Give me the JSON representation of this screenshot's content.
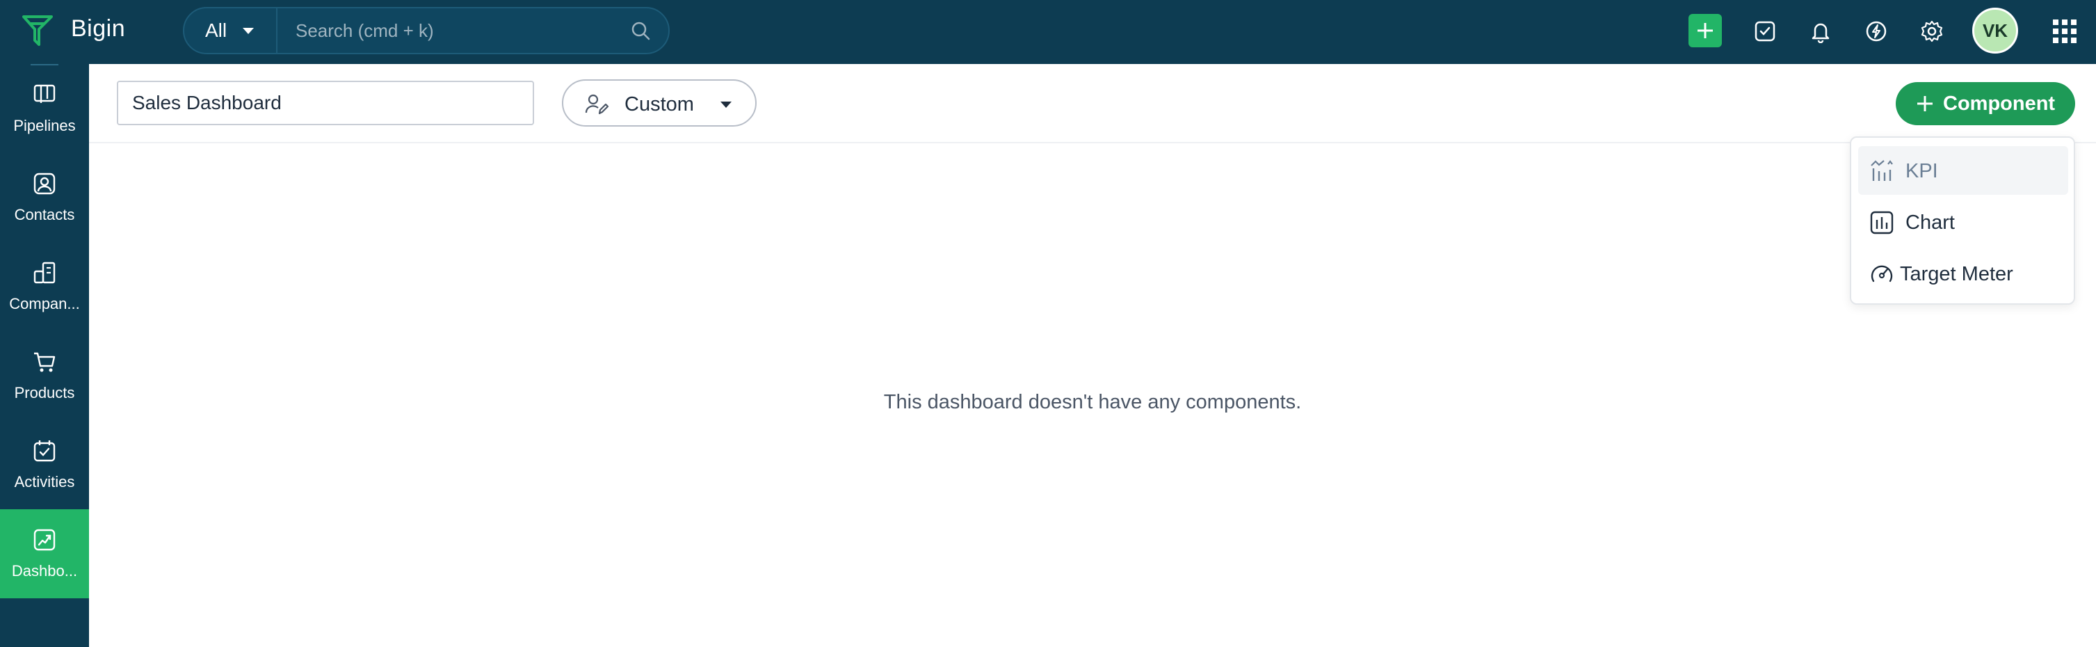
{
  "app": {
    "name": "Bigin"
  },
  "search": {
    "scope": "All",
    "placeholder": "Search (cmd + k)"
  },
  "user": {
    "initials": "VK"
  },
  "sidebar": {
    "items": [
      {
        "label": "Pipelines",
        "icon": "pipelines-icon"
      },
      {
        "label": "Contacts",
        "icon": "contacts-icon"
      },
      {
        "label": "Compan...",
        "icon": "companies-icon"
      },
      {
        "label": "Products",
        "icon": "products-icon"
      },
      {
        "label": "Activities",
        "icon": "activities-icon"
      },
      {
        "label": "Dashbo...",
        "icon": "dashboards-icon",
        "active": true
      }
    ]
  },
  "dashboard": {
    "title": "Sales Dashboard",
    "type_label": "Custom",
    "add_component_label": "Component",
    "empty_message": "This dashboard doesn't have any components."
  },
  "component_menu": {
    "items": [
      {
        "label": "KPI",
        "icon": "kpi-icon",
        "highlighted": true
      },
      {
        "label": "Chart",
        "icon": "chart-icon"
      },
      {
        "label": "Target Meter",
        "icon": "target-meter-icon"
      }
    ]
  },
  "colors": {
    "nav_bg": "#0d3c52",
    "accent_green": "#22b567",
    "button_green": "#1e9a57"
  }
}
